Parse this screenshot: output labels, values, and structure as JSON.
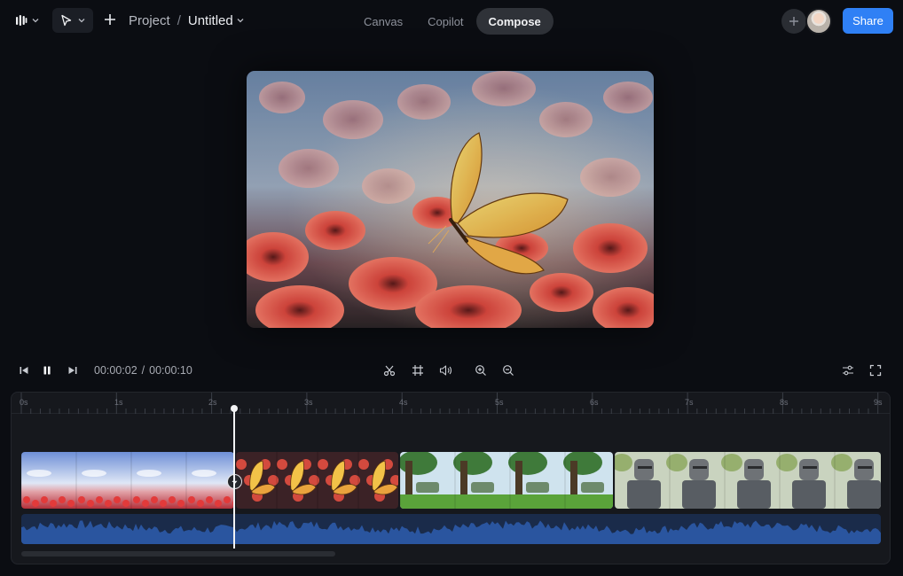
{
  "topbar": {
    "logo_icon": "logo-bars-icon",
    "tool_icon": "cursor-arrow-icon",
    "new_icon": "plus-icon",
    "breadcrumb": {
      "project": "Project",
      "separator": "/",
      "file": "Untitled"
    },
    "tabs": [
      {
        "label": "Canvas",
        "active": false
      },
      {
        "label": "Copilot",
        "active": false
      },
      {
        "label": "Compose",
        "active": true
      }
    ],
    "share_label": "Share",
    "accent_color": "#2f80f5"
  },
  "preview": {
    "scene": "butterfly-on-red-flowers"
  },
  "transport": {
    "current_time": "00:00:02",
    "separator": "/",
    "total_time": "00:00:10",
    "icons": [
      "skip-back-icon",
      "pause-icon",
      "skip-forward-icon",
      "scissors-icon",
      "crop-icon",
      "volume-icon",
      "zoom-in-icon",
      "zoom-out-icon",
      "adjust-icon",
      "fullscreen-icon"
    ]
  },
  "timeline": {
    "ruler": [
      "0s",
      "1s",
      "2s",
      "3s",
      "4s",
      "5s",
      "6s",
      "7s",
      "8s",
      "9s"
    ],
    "clips": [
      {
        "name": "flower-field-sky"
      },
      {
        "name": "butterfly-flowers"
      },
      {
        "name": "green-forest-tree"
      },
      {
        "name": "knight-armor"
      }
    ],
    "playhead_time": "2.2s"
  }
}
